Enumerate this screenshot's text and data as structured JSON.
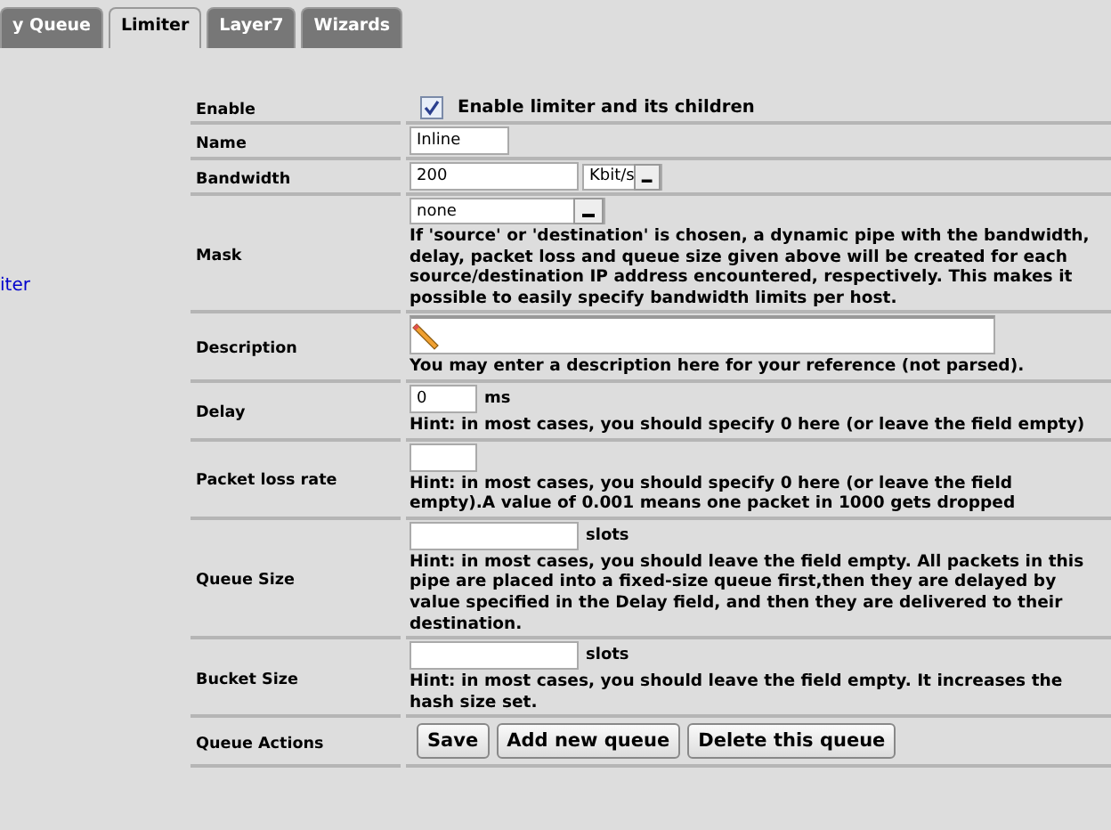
{
  "tabs": [
    {
      "label": "y Queue",
      "selected": false
    },
    {
      "label": "Limiter",
      "selected": true
    },
    {
      "label": "Layer7",
      "selected": false
    },
    {
      "label": "Wizards",
      "selected": false
    }
  ],
  "sidebar_link": "iter",
  "rows": [
    {
      "label": "Enable",
      "kind": "checkbox",
      "checked": true,
      "text": "Enable limiter and its children"
    },
    {
      "label": "Name",
      "kind": "text",
      "value": "Inline"
    },
    {
      "label": "Bandwidth",
      "kind": "bandwidth",
      "value": "200",
      "unit": "Kbit/s"
    },
    {
      "label": "Mask",
      "kind": "mask",
      "value": "none",
      "hint": "If 'source' or 'destination' is chosen, a dynamic pipe with the bandwidth, delay, packet loss and queue size given above will be created for each source/destination IP address encountered, respectively. This makes it possible to easily specify bandwidth limits per host."
    },
    {
      "label": "Description",
      "kind": "description",
      "hint": "You may enter a description here for your reference (not parsed)."
    },
    {
      "label": "Delay",
      "kind": "number",
      "value": "0",
      "unit": "ms",
      "hint": "Hint: in most cases, you should specify 0 here (or leave the field empty)"
    },
    {
      "label": "Packet loss rate",
      "kind": "number",
      "hint": "Hint: in most cases, you should specify 0 here (or leave the field empty).A value of 0.001 means one packet in 1000 gets dropped"
    },
    {
      "label": "Queue Size",
      "kind": "slots",
      "unit": "slots",
      "hint": "Hint: in most cases, you should leave the field empty. All packets in this pipe are placed into a fixed-size queue first,then they are delayed by value specified in the Delay field, and then they are delivered to their destination."
    },
    {
      "label": "Bucket Size",
      "kind": "slots",
      "unit": "slots",
      "hint": "Hint: in most cases, you should leave the field empty. It increases the hash size set."
    },
    {
      "label": "Queue Actions",
      "kind": "actions",
      "buttons": [
        "Save",
        "Add new queue",
        "Delete this queue"
      ]
    }
  ]
}
